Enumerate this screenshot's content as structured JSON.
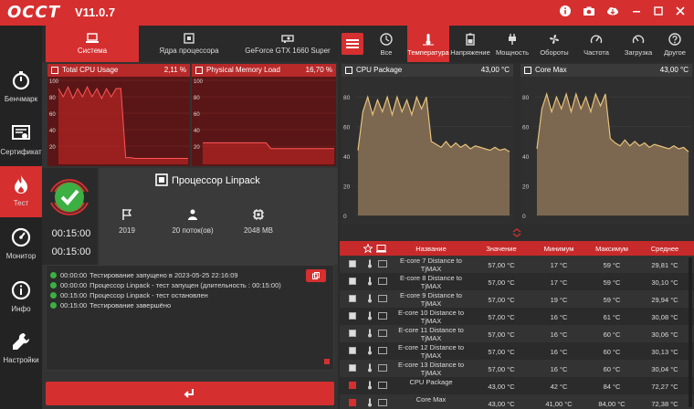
{
  "titlebar": {
    "logo": "OCCT",
    "version": "V11.0.7",
    "buttons": [
      "info-icon",
      "camera-icon",
      "cloud-icon",
      "minimize-icon",
      "maximize-icon",
      "close-icon"
    ]
  },
  "sidebar": {
    "items": [
      {
        "label": "Бенчмарк",
        "icon": "stopwatch-icon",
        "active": false
      },
      {
        "label": "Сертификат",
        "icon": "certificate-icon",
        "active": false
      },
      {
        "label": "Тест",
        "icon": "flame-icon",
        "active": true
      },
      {
        "label": "Монитор",
        "icon": "gauge-icon",
        "active": false
      },
      {
        "label": "Инфо",
        "icon": "info-icon",
        "active": false
      },
      {
        "label": "Настройки",
        "icon": "wrench-icon",
        "active": false
      }
    ]
  },
  "left_tabs": [
    {
      "label": "Система",
      "active": true
    },
    {
      "label": "Ядра процессора",
      "active": false
    },
    {
      "label": "GeForce GTX 1660 Super",
      "active": false
    }
  ],
  "usage": {
    "cpu_label": "Total CPU Usage",
    "cpu_value": "2,11 %",
    "mem_label": "Physical Memory Load",
    "mem_value": "16,70 %",
    "y_ticks": [
      "100",
      "80",
      "60",
      "40",
      "20"
    ],
    "cpu_series": [
      90,
      80,
      92,
      78,
      90,
      80,
      92,
      80,
      90,
      78,
      90,
      80,
      90,
      90,
      6,
      6,
      5,
      5,
      5,
      5,
      5,
      5,
      5,
      5,
      5,
      5,
      5,
      5
    ],
    "mem_series": [
      24,
      24,
      24,
      24,
      24,
      24,
      24,
      24,
      24,
      24,
      24,
      24,
      24,
      24,
      17,
      17,
      17,
      17,
      17,
      17,
      17,
      17,
      17,
      17,
      17,
      17,
      17,
      17
    ]
  },
  "test": {
    "title": "Процессор Linpack",
    "elapsed": "00:15:00",
    "duration": "00:15:00",
    "stats": [
      {
        "icon": "flag-icon",
        "value": "2019"
      },
      {
        "icon": "cpu-thread-icon",
        "value": "20 поток(ов)"
      },
      {
        "icon": "memory-chip-icon",
        "value": "2048 MB"
      }
    ]
  },
  "log": [
    {
      "time": "00:00:00",
      "text": "Тестирование запущено в 2023-05-25 22:16:09"
    },
    {
      "time": "00:00:00",
      "text": "Процессор Linpack - тест запущен (длительность : 00:15:00)"
    },
    {
      "time": "00:15:00",
      "text": "Процессор Linpack - тест остановлен"
    },
    {
      "time": "00:15:00",
      "text": "Тестирование завершёно"
    }
  ],
  "right_tabs": [
    {
      "label": "Все",
      "icon": "clock-icon",
      "active": false
    },
    {
      "label": "Температура",
      "icon": "thermometer-icon",
      "active": true
    },
    {
      "label": "Напряжение",
      "icon": "battery-icon",
      "active": false
    },
    {
      "label": "Мощность",
      "icon": "plug-icon",
      "active": false
    },
    {
      "label": "Обороты",
      "icon": "fan-icon",
      "active": false
    },
    {
      "label": "Частота",
      "icon": "speedometer-icon",
      "active": false
    },
    {
      "label": "Загрузка",
      "icon": "load-gauge-icon",
      "active": false
    },
    {
      "label": "Другое",
      "icon": "question-icon",
      "active": false
    }
  ],
  "temp_charts": [
    {
      "label": "CPU Package",
      "value": "43,00 °C",
      "y_ticks": [
        "80",
        "60",
        "40",
        "20",
        "0"
      ],
      "series": [
        44,
        70,
        80,
        68,
        78,
        70,
        80,
        68,
        80,
        70,
        78,
        68,
        80,
        72,
        80,
        50,
        48,
        46,
        50,
        46,
        49,
        46,
        48,
        45,
        47,
        46,
        45,
        44,
        46,
        44,
        45,
        43
      ]
    },
    {
      "label": "Core Max",
      "value": "43,00 °C",
      "y_ticks": [
        "80",
        "60",
        "40",
        "20",
        "0"
      ],
      "series": [
        45,
        72,
        82,
        70,
        80,
        72,
        82,
        70,
        82,
        72,
        80,
        70,
        82,
        74,
        82,
        52,
        49,
        47,
        51,
        47,
        50,
        47,
        49,
        46,
        48,
        47,
        46,
        45,
        47,
        45,
        46,
        43
      ]
    }
  ],
  "table": {
    "headers": [
      "Название",
      "Значение",
      "Минимум",
      "Максимум",
      "Среднее"
    ],
    "rows": [
      {
        "name": "E-core 7 Distance to TjMAX",
        "value": "57,00 °C",
        "min": "17 °C",
        "max": "59 °C",
        "avg": "29,81 °C",
        "checked": false
      },
      {
        "name": "E-core 8 Distance to TjMAX",
        "value": "57,00 °C",
        "min": "17 °C",
        "max": "59 °C",
        "avg": "30,10 °C",
        "checked": false
      },
      {
        "name": "E-core 9 Distance to TjMAX",
        "value": "57,00 °C",
        "min": "19 °C",
        "max": "59 °C",
        "avg": "29,94 °C",
        "checked": false
      },
      {
        "name": "E-core 10 Distance to TjMAX",
        "value": "57,00 °C",
        "min": "16 °C",
        "max": "61 °C",
        "avg": "30,08 °C",
        "checked": false
      },
      {
        "name": "E-core 11 Distance to TjMAX",
        "value": "57,00 °C",
        "min": "16 °C",
        "max": "60 °C",
        "avg": "30,06 °C",
        "checked": false
      },
      {
        "name": "E-core 12 Distance to TjMAX",
        "value": "57,00 °C",
        "min": "16 °C",
        "max": "60 °C",
        "avg": "30,13 °C",
        "checked": false
      },
      {
        "name": "E-core 13 Distance to TjMAX",
        "value": "57,00 °C",
        "min": "16 °C",
        "max": "60 °C",
        "avg": "30,04 °C",
        "checked": false
      },
      {
        "name": "CPU Package",
        "value": "43,00 °C",
        "min": "42 °C",
        "max": "84 °C",
        "avg": "72,27 °C",
        "checked": true
      },
      {
        "name": "Core Max",
        "value": "43,00 °C",
        "min": "41,00 °C",
        "max": "84,00 °C",
        "avg": "72,38 °C",
        "checked": true
      }
    ]
  },
  "colors": {
    "accent": "#d62f2f",
    "success": "#3cb043",
    "chart_fill": "#8a7257",
    "chart_line": "#e8c27a"
  }
}
